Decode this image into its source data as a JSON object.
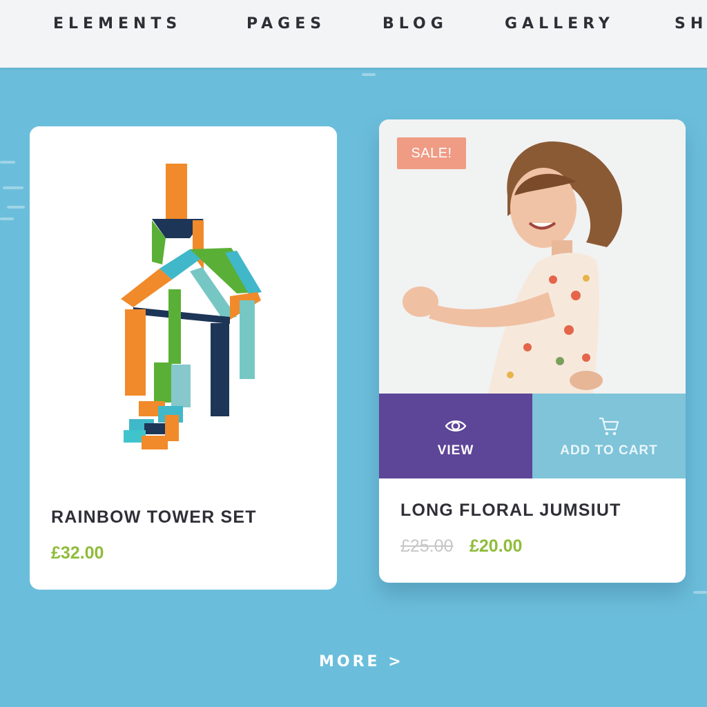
{
  "nav": {
    "items": [
      "ELEMENTS",
      "PAGES",
      "BLOG",
      "GALLERY",
      "SH"
    ]
  },
  "products": [
    {
      "title": "RAINBOW TOWER SET",
      "price": "£32.00",
      "image_alt": "rainbow tower toy"
    },
    {
      "badge": "SALE!",
      "title": "LONG FLORAL JUMSIUT",
      "old_price": "£25.00",
      "price": "£20.00",
      "image_alt": "girl in floral jumpsuit",
      "actions": {
        "view": "VIEW",
        "add_to_cart": "ADD TO CART"
      }
    }
  ],
  "more": {
    "label": "MORE >"
  },
  "colors": {
    "background": "#6bbedb",
    "nav_bg": "#f3f4f5",
    "price_green": "#8fbc3a",
    "sale_badge": "#f09b84",
    "view_purple": "#5d4597",
    "cart_blue": "#7fc4d9"
  }
}
